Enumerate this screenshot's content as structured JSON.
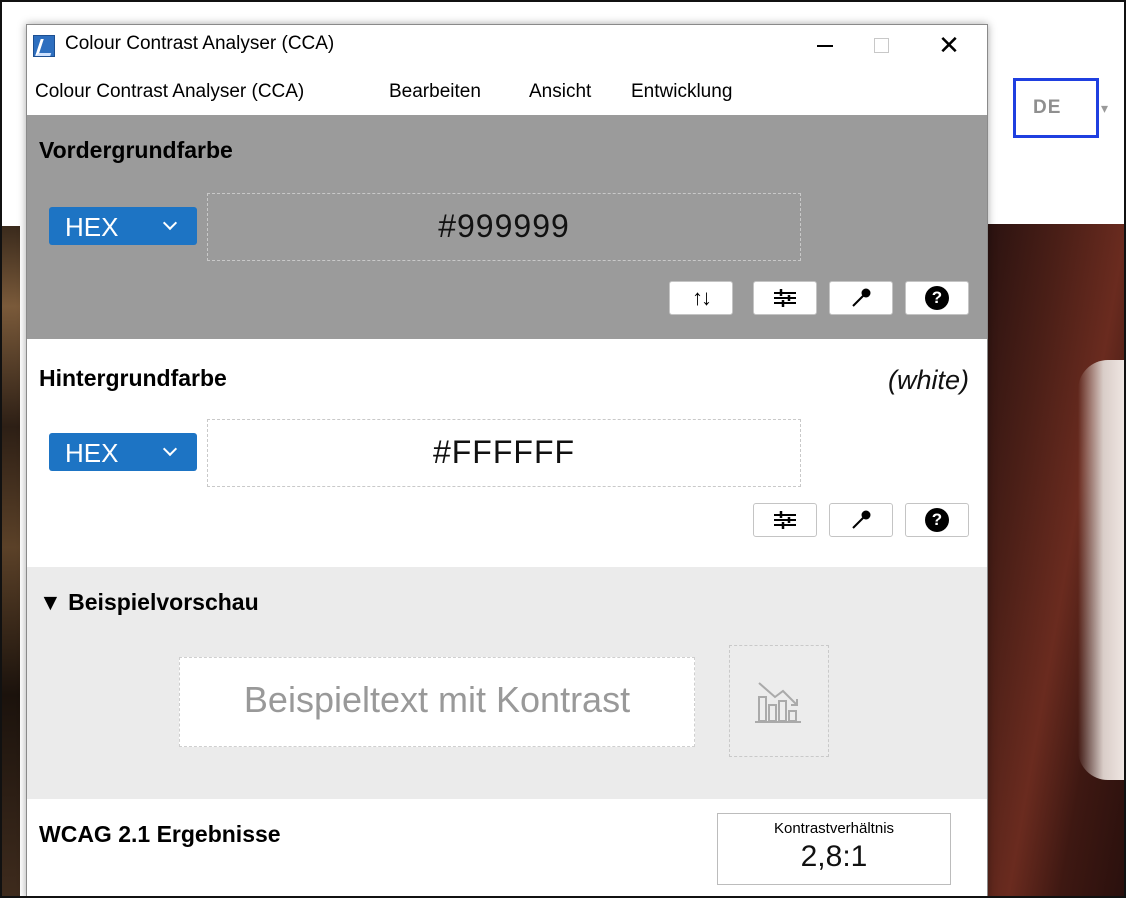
{
  "website": {
    "language_selector": {
      "value": "DE",
      "caret": "▾"
    }
  },
  "window": {
    "title": "Colour Contrast Analyser (CCA)",
    "controls": {
      "minimize": "–",
      "maximize": "□",
      "close": "✕"
    }
  },
  "menu": {
    "items": [
      {
        "label": "Colour Contrast Analyser (CCA)"
      },
      {
        "label": "Bearbeiten"
      },
      {
        "label": "Ansicht"
      },
      {
        "label": "Entwicklung"
      }
    ]
  },
  "foreground": {
    "title": "Vordergrundfarbe",
    "format": "HEX",
    "value": "#999999",
    "background_color": "#9b9b9b",
    "tools": {
      "swap": "↑↓",
      "sliders": "sliders-icon",
      "picker": "eyedropper-icon",
      "help": "?"
    }
  },
  "background": {
    "title": "Hintergrundfarbe",
    "color_name": "(white)",
    "format": "HEX",
    "value": "#FFFFFF",
    "tools": {
      "sliders": "sliders-icon",
      "picker": "eyedropper-icon",
      "help": "?"
    }
  },
  "preview": {
    "title": "▼ Beispielvorschau",
    "sample_text": "Beispieltext mit Kontrast",
    "sample_color": "#999999",
    "chart_button_icon": "contrast-chart-icon"
  },
  "results": {
    "title": "WCAG 2.1 Ergebnisse",
    "ratio_label": "Kontrastverhältnis",
    "ratio_value": "2,8:1"
  },
  "colors": {
    "accent": "#1d74c4",
    "focus_outline": "#1f3fe0",
    "preview_bg": "#ebebeb"
  }
}
